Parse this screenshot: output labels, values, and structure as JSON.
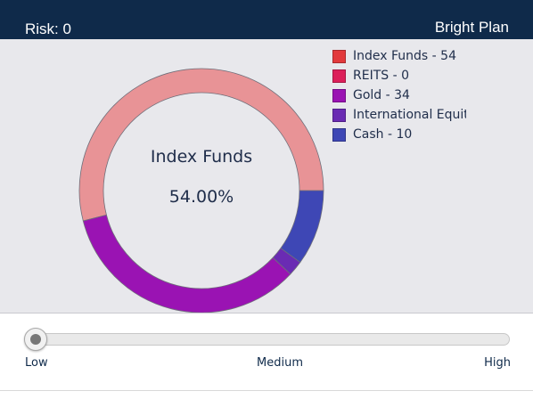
{
  "header": {
    "risk_label": "Risk: 0",
    "plan_title": "Bright Plan"
  },
  "chart_data": {
    "type": "pie",
    "style": "donut",
    "slices": [
      {
        "name": "Index Funds",
        "value": 54,
        "color": "#e89396"
      },
      {
        "name": "REITS",
        "value": 0,
        "color": "#dc1f5a"
      },
      {
        "name": "Gold",
        "value": 34,
        "color": "#9a13b3"
      },
      {
        "name": "International Equity",
        "value": 2,
        "color": "#6a2bb3"
      },
      {
        "name": "Cash",
        "value": 10,
        "color": "#3e47b5"
      }
    ],
    "highlight": {
      "name": "Index Funds",
      "percent": "54.00%"
    }
  },
  "legend": {
    "items": [
      {
        "label": "Index Funds - 54",
        "color": "#e2393c"
      },
      {
        "label": "REITS - 0",
        "color": "#dc1f5a"
      },
      {
        "label": "Gold - 34",
        "color": "#9a13b3"
      },
      {
        "label": "International Equity",
        "color": "#6a2bb3"
      },
      {
        "label": "Cash - 10",
        "color": "#3e47b5"
      }
    ]
  },
  "slider": {
    "value": 0,
    "min_label": "Low",
    "mid_label": "Medium",
    "max_label": "High"
  }
}
